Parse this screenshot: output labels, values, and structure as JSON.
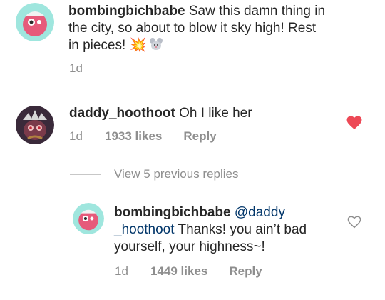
{
  "comments": [
    {
      "username": "bombingbichbabe",
      "text": "Saw this damn thing in the city, so about to blow it sky high! Rest in pieces! 💥🐭",
      "line1": " Saw this damn thing in",
      "line2": "the city, so about to blow it sky high! Rest",
      "line3": "in pieces! 💥",
      "time": "1d"
    },
    {
      "username": "daddy_hoothoot",
      "text": "Oh I like her",
      "time": "1d",
      "likes": "1933 likes",
      "reply_label": "Reply",
      "liked": true,
      "heart_color": "#ed4956"
    }
  ],
  "view_replies": "View 5 previous replies",
  "reply": {
    "username": "bombingbichbabe",
    "mention_part1": "@daddy",
    "mention_part2": "_hoothoot",
    "text_line2": " Thanks! you ain’t bad",
    "text_line3": "yourself, your highness~!",
    "time": "1d",
    "likes": "1449 likes",
    "reply_label": "Reply",
    "liked": false
  },
  "colors": {
    "text": "#262626",
    "muted": "#8e8e8e",
    "mention": "#003569",
    "heart_liked": "#ed4956"
  }
}
